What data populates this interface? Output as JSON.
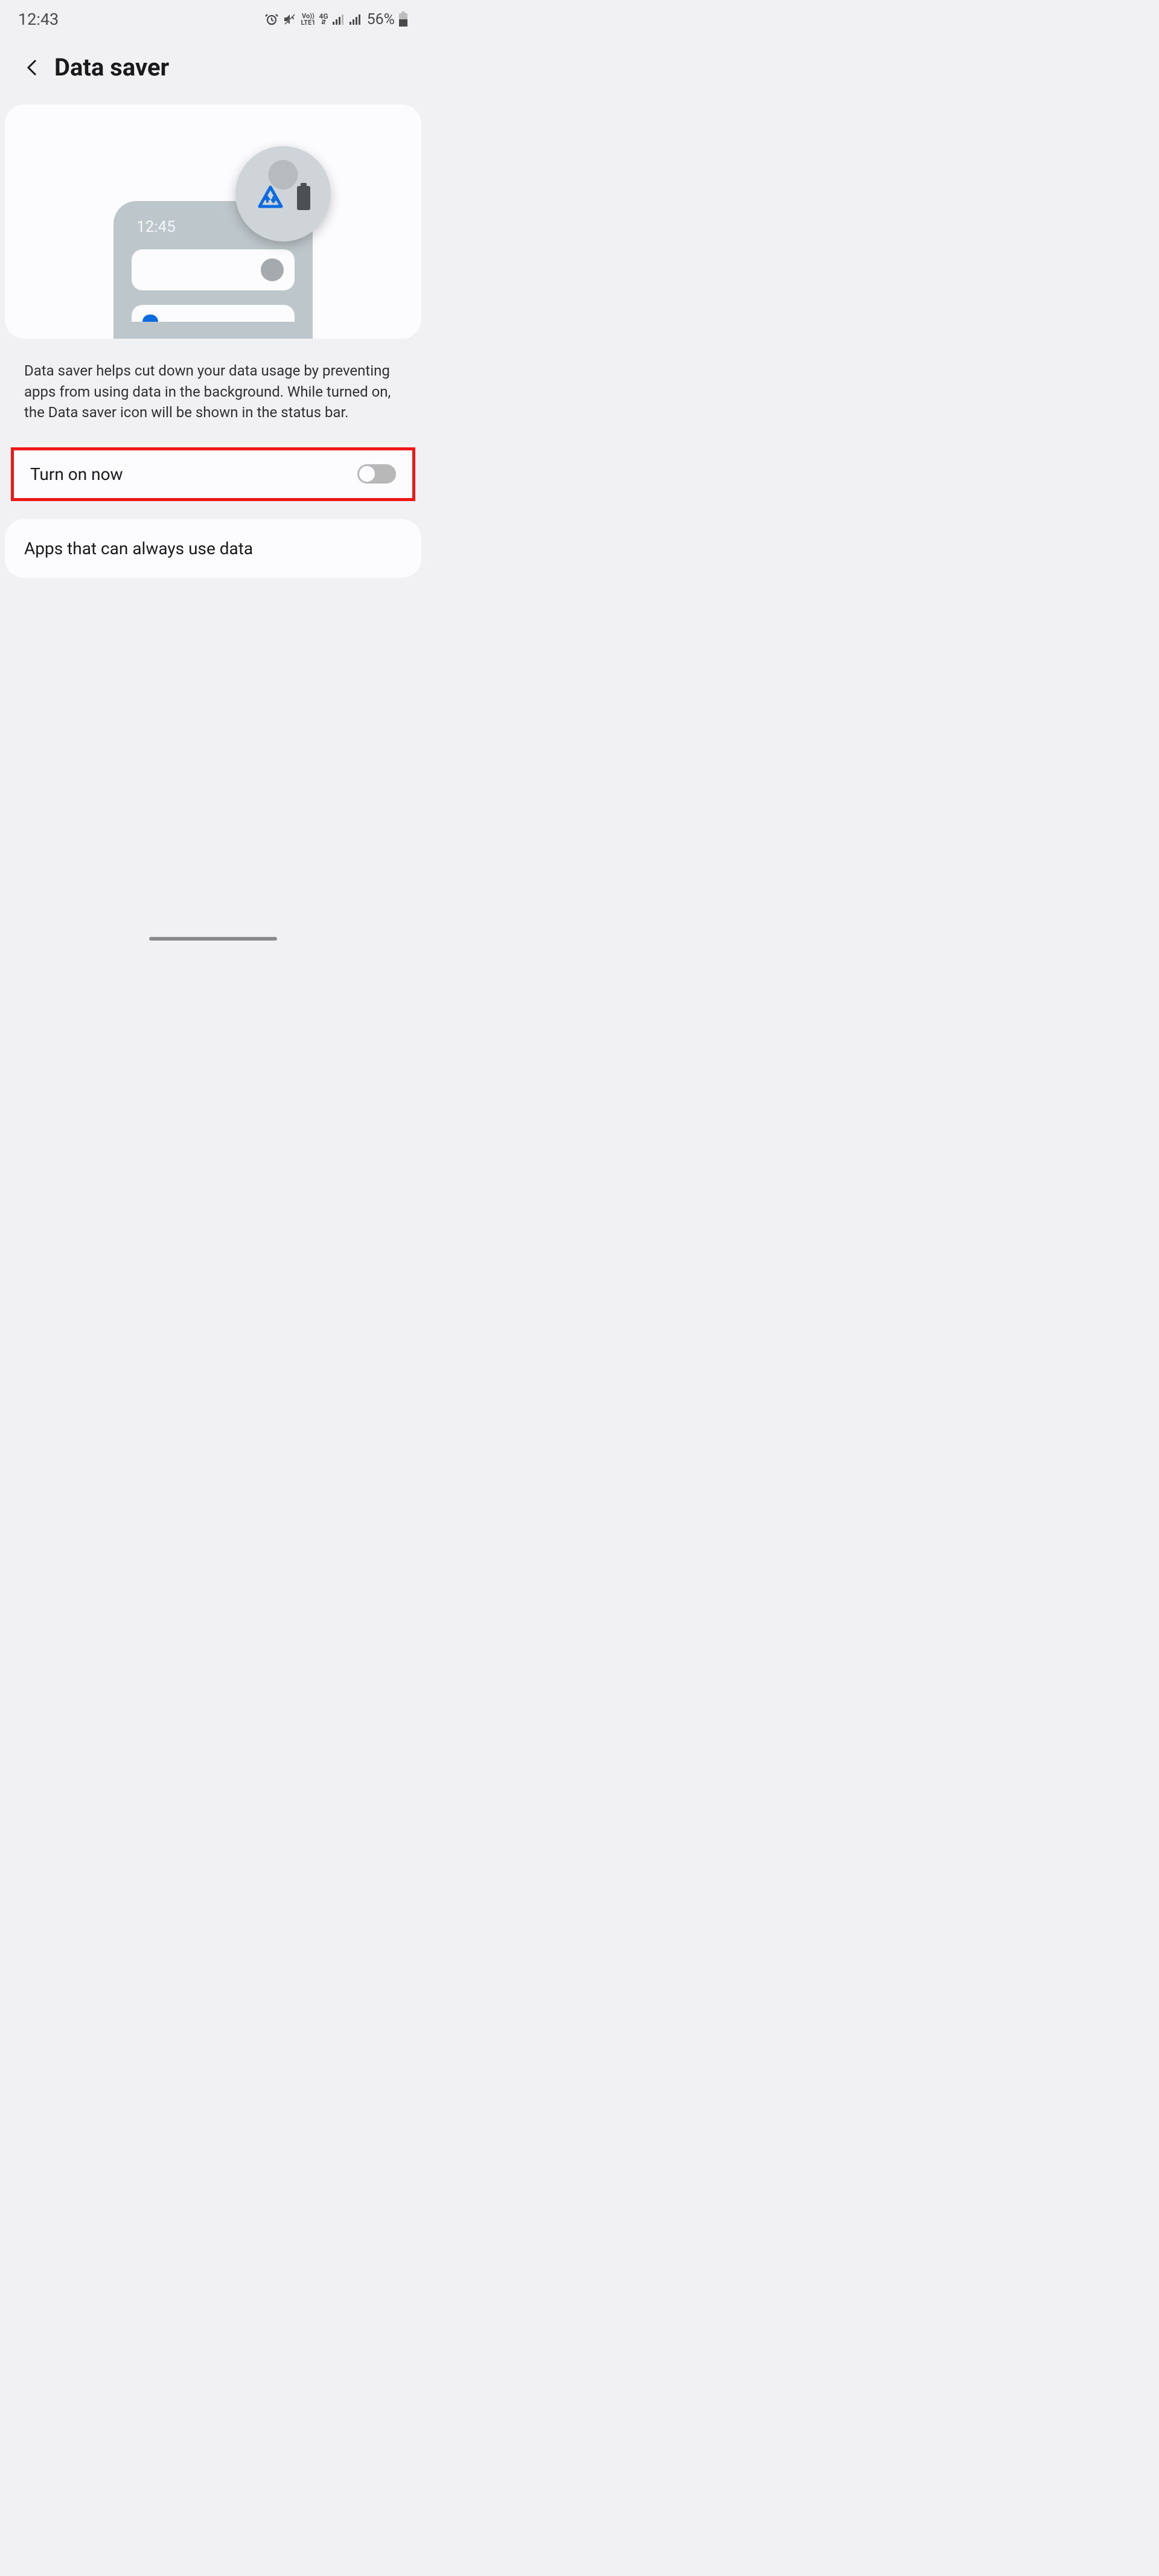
{
  "status_bar": {
    "time": "12:43",
    "battery_percent": "56%",
    "network_line1": "Vo))",
    "network_line2": "LTE1",
    "net_gen": "4G"
  },
  "header": {
    "title": "Data saver"
  },
  "illustration": {
    "phone_time": "12:45"
  },
  "description": "Data saver helps cut down your data usage by preventing apps from using data in the background. While turned on, the Data saver icon will be shown in the status bar.",
  "toggle": {
    "label": "Turn on now"
  },
  "option": {
    "label": "Apps that can always use data"
  }
}
